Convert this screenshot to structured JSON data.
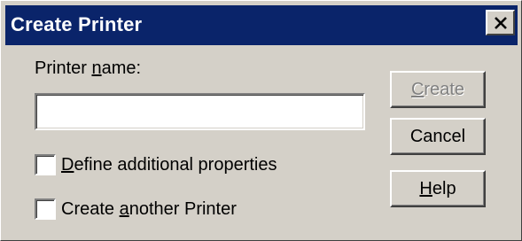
{
  "window": {
    "title": "Create Printer",
    "close_icon": "close-icon"
  },
  "form": {
    "name_label_pre": "Printer ",
    "name_label_mnemonic": "n",
    "name_label_post": "ame:",
    "name_value": "",
    "checkbox_define": {
      "mnemonic": "D",
      "rest": "efine additional properties",
      "checked": false
    },
    "checkbox_another": {
      "pre": "Create ",
      "mnemonic": "a",
      "post": "nother Printer",
      "checked": false
    }
  },
  "buttons": {
    "create": {
      "mnemonic": "C",
      "rest": "reate",
      "enabled": false
    },
    "cancel": {
      "label": "Cancel"
    },
    "help": {
      "mnemonic": "H",
      "rest": "elp"
    }
  },
  "colors": {
    "titlebar": "#0a246a",
    "face": "#d4d0c8",
    "disabled_text": "#808080"
  }
}
